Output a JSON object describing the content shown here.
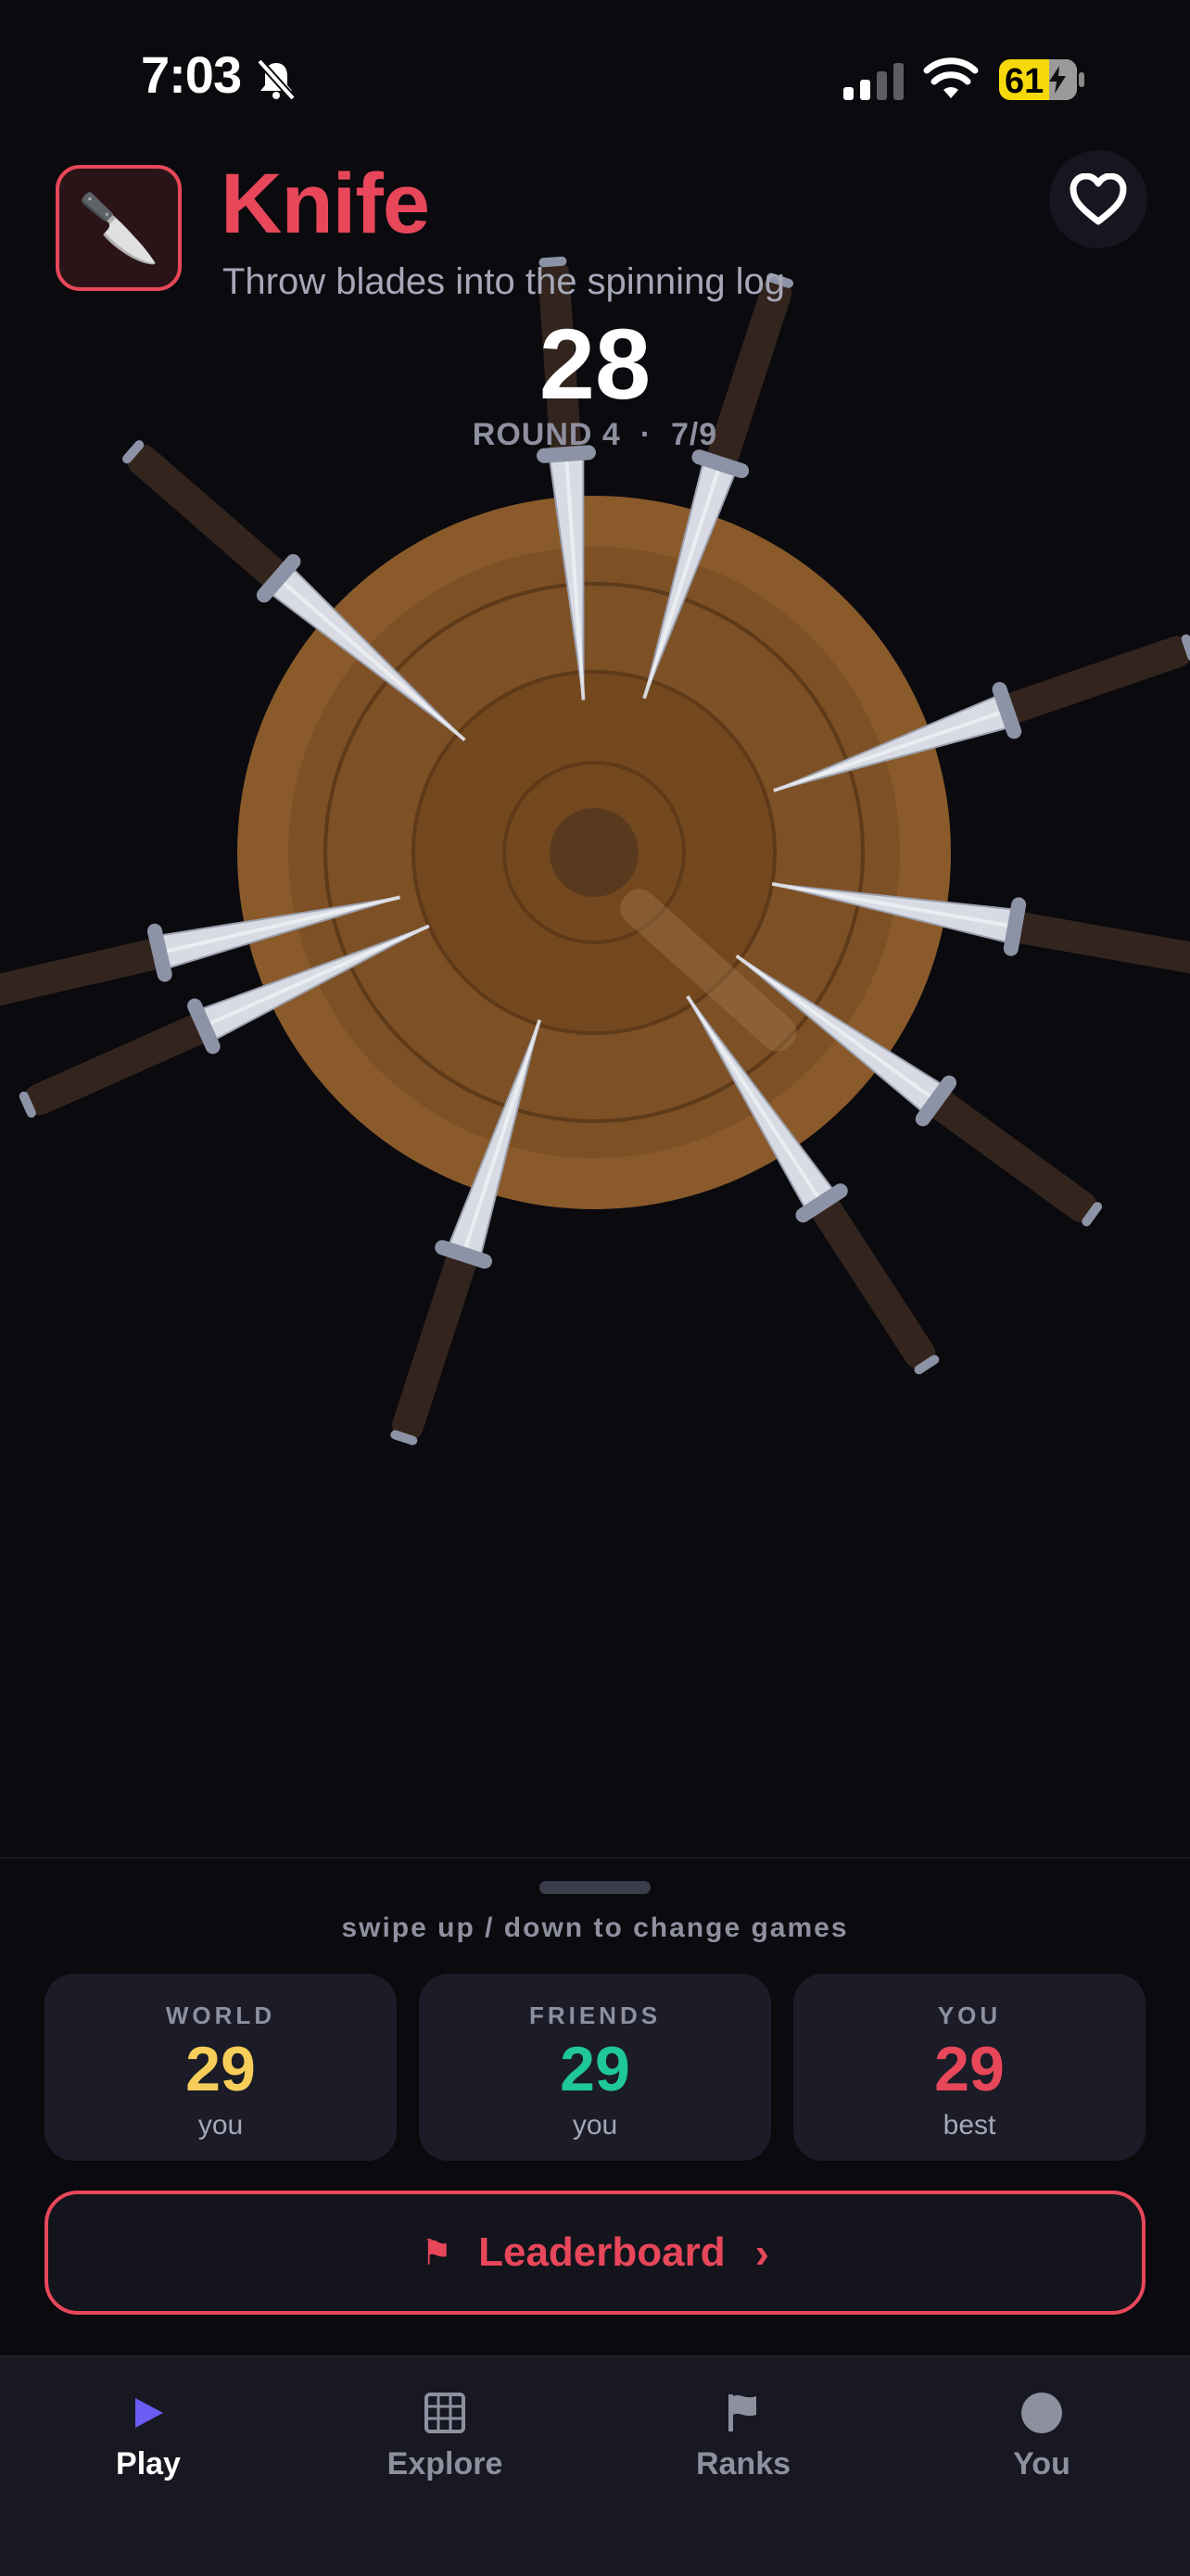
{
  "status_bar": {
    "time": "7:03",
    "battery": "61"
  },
  "header": {
    "app_icon": "knife-emoji",
    "title": "Knife",
    "subtitle": "Throw blades into the spinning log"
  },
  "game": {
    "score": "28",
    "round_label": "ROUND 4",
    "separator": "·",
    "progress": "7/9",
    "colors": {
      "log_outer": "#8a5a2b",
      "log_inner": "#7a4d24",
      "blade": "#d8dbe3",
      "handle": "#3a2a22"
    }
  },
  "sheet": {
    "swipe_hint": "swipe up / down to change games",
    "cards": [
      {
        "label": "WORLD",
        "value": "29",
        "sub": "you",
        "color": "#f7cd5a"
      },
      {
        "label": "FRIENDS",
        "value": "29",
        "sub": "you",
        "color": "#1fc79a"
      },
      {
        "label": "YOU",
        "value": "29",
        "sub": "best",
        "color": "#e8475a"
      }
    ],
    "leaderboard": {
      "icon": "⚑",
      "label": "Leaderboard",
      "chevron": "›"
    }
  },
  "tabs": [
    {
      "label": "Play",
      "icon": "play-icon",
      "active": true
    },
    {
      "label": "Explore",
      "icon": "grid-icon",
      "active": false
    },
    {
      "label": "Ranks",
      "icon": "flag-icon",
      "active": false
    },
    {
      "label": "You",
      "icon": "profile-icon",
      "active": false
    }
  ],
  "colors": {
    "accent": "#e8475a",
    "tab_active_icon": "#6b5cf6",
    "background": "#0a0a0f"
  }
}
